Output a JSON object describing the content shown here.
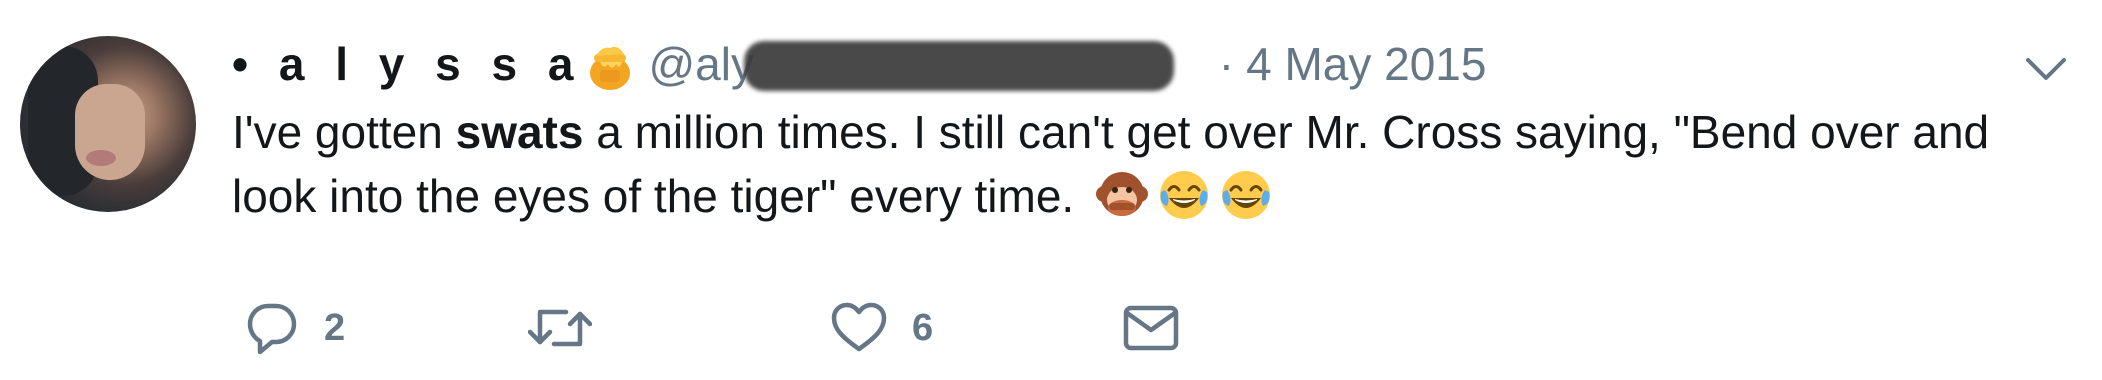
{
  "tweet": {
    "display_name": "• a l y s s a",
    "name_emoji": "honey-pot-icon",
    "handle": "@aly",
    "separator": "·",
    "date": "4 May 2015",
    "text_part1": "I've gotten ",
    "text_bold": "swats",
    "text_part2": " a million times. I still can't get over Mr. Cross saying, \"Bend over and look into the eyes of the tiger\" every time.",
    "emojis": [
      "speak-no-evil-monkey-icon",
      "tears-of-joy-icon",
      "tears-of-joy-icon"
    ]
  },
  "actions": {
    "reply_count": "2",
    "retweet_count": "",
    "like_count": "6"
  },
  "colors": {
    "text": "#14171a",
    "secondary": "#657786",
    "background": "#ffffff"
  }
}
